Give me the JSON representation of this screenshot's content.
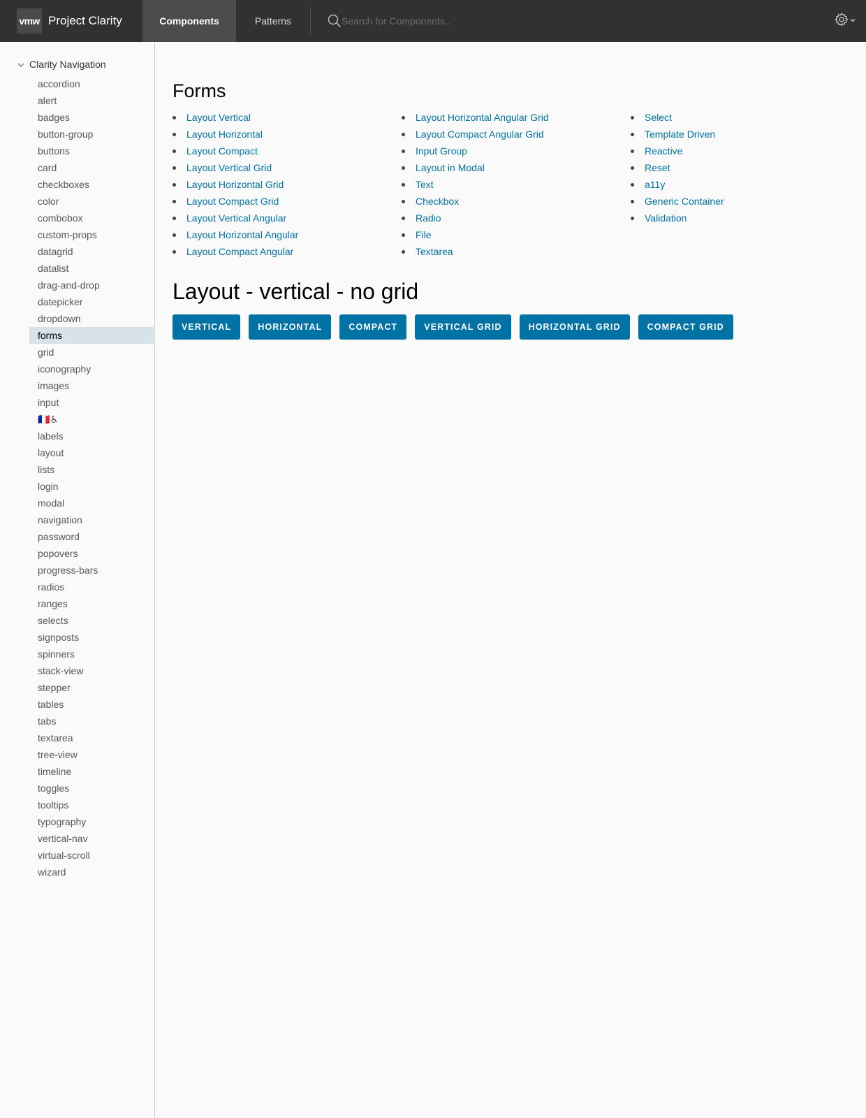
{
  "header": {
    "logo": "vmw",
    "brand": "Project Clarity",
    "tabs": [
      {
        "label": "Components",
        "active": true
      },
      {
        "label": "Patterns",
        "active": false
      }
    ],
    "search_placeholder": "Search for Components..",
    "settings_icon": "gear-icon"
  },
  "sidebar": {
    "title": "Clarity Navigation",
    "items": [
      "accordion",
      "alert",
      "badges",
      "button-group",
      "buttons",
      "card",
      "checkboxes",
      "color",
      "combobox",
      "custom-props",
      "datagrid",
      "datalist",
      "drag-and-drop",
      "datepicker",
      "dropdown",
      "forms",
      "grid",
      "iconography",
      "images",
      "input",
      "🇫🇷♿",
      "labels",
      "layout",
      "lists",
      "login",
      "modal",
      "navigation",
      "password",
      "popovers",
      "progress-bars",
      "radios",
      "ranges",
      "selects",
      "signposts",
      "spinners",
      "stack-view",
      "stepper",
      "tables",
      "tabs",
      "textarea",
      "tree-view",
      "timeline",
      "toggles",
      "tooltips",
      "typography",
      "vertical-nav",
      "virtual-scroll",
      "wizard"
    ],
    "active_item": "forms"
  },
  "main": {
    "title": "Forms",
    "link_columns": [
      [
        "Layout Vertical",
        "Layout Horizontal",
        "Layout Compact",
        "Layout Vertical Grid",
        "Layout Horizontal Grid",
        "Layout Compact Grid",
        "Layout Vertical Angular",
        "Layout Horizontal Angular",
        "Layout Compact Angular"
      ],
      [
        "Layout Horizontal Angular Grid",
        "Layout Compact Angular Grid",
        "Input Group",
        "Layout in Modal",
        "Text",
        "Checkbox",
        "Radio",
        "File",
        "Textarea"
      ],
      [
        "Select",
        "Template Driven",
        "Reactive",
        "Reset",
        "a11y",
        "Generic Container",
        "Validation"
      ]
    ],
    "section_title": "Layout - vertical - no grid",
    "buttons": [
      "VERTICAL",
      "HORIZONTAL",
      "COMPACT",
      "VERTICAL GRID",
      "HORIZONTAL GRID",
      "COMPACT GRID"
    ]
  },
  "colors": {
    "header_bg": "#313131",
    "link": "#0072a3",
    "button_bg": "#0072a3",
    "active_nav_bg": "#d8e3e9"
  }
}
